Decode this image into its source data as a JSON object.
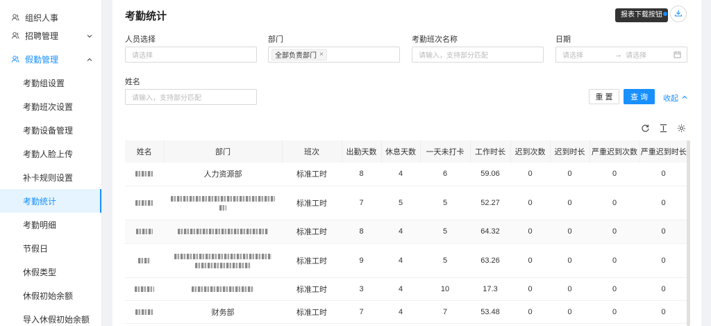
{
  "sidebar": {
    "items": [
      {
        "label": "组织人事",
        "icon": "people-icon",
        "expandable": false
      },
      {
        "label": "招聘管理",
        "icon": "people-icon",
        "expandable": true,
        "expanded": false
      },
      {
        "label": "假勤管理",
        "icon": "people-icon",
        "expandable": true,
        "expanded": true
      }
    ],
    "sub_items": [
      "考勤组设置",
      "考勤班次设置",
      "考勤设备管理",
      "考勤人脸上传",
      "补卡规则设置",
      "考勤统计",
      "考勤明细",
      "节假日",
      "休假类型",
      "休假初始余额",
      "导入休假初始余额"
    ],
    "active_sub": "考勤统计"
  },
  "page": {
    "title": "考勤统计",
    "download_tooltip": "报表下载按钮"
  },
  "filters": {
    "person": {
      "label": "人员选择",
      "placeholder": "请选择"
    },
    "department": {
      "label": "部门",
      "tag": "全部负责部门",
      "tag_close": "×"
    },
    "shift_name": {
      "label": "考勤班次名称",
      "placeholder": "请输入，支持部分匹配"
    },
    "date": {
      "label": "日期",
      "start_placeholder": "请选择",
      "arrow": "→",
      "end_placeholder": "请选择"
    },
    "name": {
      "label": "姓名",
      "placeholder": "请输入，支持部分匹配"
    }
  },
  "actions": {
    "reset": "重 置",
    "query": "查 询",
    "collapse": "收起"
  },
  "table": {
    "headers": [
      "姓名",
      "部门",
      "班次",
      "出勤天数",
      "休息天数",
      "一天未打卡",
      "工作时长",
      "迟到次数",
      "迟到时长",
      "严重迟到次数",
      "严重迟到时长"
    ],
    "rows": [
      {
        "dept": "人力资源部",
        "shift": "标准工时",
        "attend": "8",
        "rest": "4",
        "no_punch": "6",
        "hours": "59.06",
        "late": "0",
        "late_dur": "0",
        "severe": "0",
        "severe_dur": "0"
      },
      {
        "dept": "",
        "shift": "标准工时",
        "attend": "7",
        "rest": "5",
        "no_punch": "5",
        "hours": "52.27",
        "late": "0",
        "late_dur": "0",
        "severe": "0",
        "severe_dur": "0"
      },
      {
        "dept": "",
        "shift": "标准工时",
        "attend": "8",
        "rest": "4",
        "no_punch": "5",
        "hours": "64.32",
        "late": "0",
        "late_dur": "0",
        "severe": "0",
        "severe_dur": "0"
      },
      {
        "dept": "",
        "shift": "标准工时",
        "attend": "9",
        "rest": "4",
        "no_punch": "5",
        "hours": "63.26",
        "late": "0",
        "late_dur": "0",
        "severe": "0",
        "severe_dur": "0"
      },
      {
        "dept": "",
        "shift": "标准工时",
        "attend": "3",
        "rest": "4",
        "no_punch": "10",
        "hours": "17.3",
        "late": "0",
        "late_dur": "0",
        "severe": "0",
        "severe_dur": "0"
      },
      {
        "dept": "财务部",
        "shift": "标准工时",
        "attend": "7",
        "rest": "4",
        "no_punch": "7",
        "hours": "53.48",
        "late": "0",
        "late_dur": "0",
        "severe": "0",
        "severe_dur": "0"
      }
    ]
  },
  "colors": {
    "accent": "#1890ff",
    "active_bg": "#e6f4ff"
  }
}
